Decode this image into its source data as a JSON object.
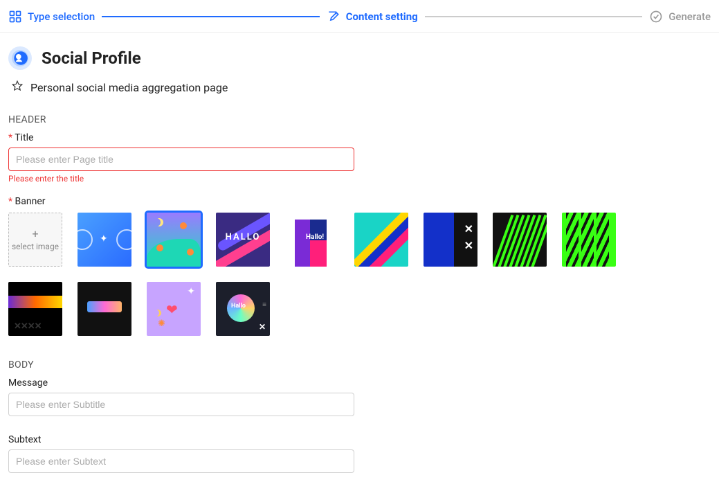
{
  "stepper": {
    "steps": [
      {
        "key": "type",
        "label": "Type selection",
        "state": "done"
      },
      {
        "key": "content",
        "label": "Content setting",
        "state": "active"
      },
      {
        "key": "generate",
        "label": "Generate",
        "state": "pending"
      }
    ]
  },
  "page": {
    "title": "Social Profile",
    "subtitle": "Personal social media aggregation page"
  },
  "sections": {
    "header_label": "HEADER",
    "body_label": "BODY"
  },
  "fields": {
    "title": {
      "label": "Title",
      "required": true,
      "placeholder": "Please enter Page title",
      "value": "",
      "error": "Please enter the title"
    },
    "banner": {
      "label": "Banner",
      "required": true,
      "upload_label": "select image",
      "selected_index": 2
    },
    "message": {
      "label": "Message",
      "placeholder": "Please enter Subtitle",
      "value": ""
    },
    "subtext": {
      "label": "Subtext",
      "placeholder": "Please enter Subtext",
      "value": ""
    }
  },
  "banners": [
    {
      "id": "upload",
      "kind": "upload"
    },
    {
      "id": "b1",
      "kind": "preset",
      "desc": "blue-sparkle"
    },
    {
      "id": "b2",
      "kind": "preset",
      "desc": "teal-wave",
      "selected": true
    },
    {
      "id": "b3",
      "kind": "preset",
      "desc": "purple-hallo",
      "text": "HALLO"
    },
    {
      "id": "b4",
      "kind": "preset",
      "desc": "blocks-hallo",
      "text": "Hallo!"
    },
    {
      "id": "b5",
      "kind": "preset",
      "desc": "diagonal-stripes"
    },
    {
      "id": "b6",
      "kind": "preset",
      "desc": "blue-xx"
    },
    {
      "id": "b7",
      "kind": "preset",
      "desc": "black-green-lines"
    },
    {
      "id": "b8",
      "kind": "preset",
      "desc": "green-chevrons"
    },
    {
      "id": "b9",
      "kind": "preset",
      "desc": "black-gradient-xxx"
    },
    {
      "id": "b10",
      "kind": "preset",
      "desc": "dark-gradient-bar"
    },
    {
      "id": "b11",
      "kind": "preset",
      "desc": "lilac-heart"
    },
    {
      "id": "b12",
      "kind": "preset",
      "desc": "holo-orb",
      "text": "Hallo"
    }
  ]
}
